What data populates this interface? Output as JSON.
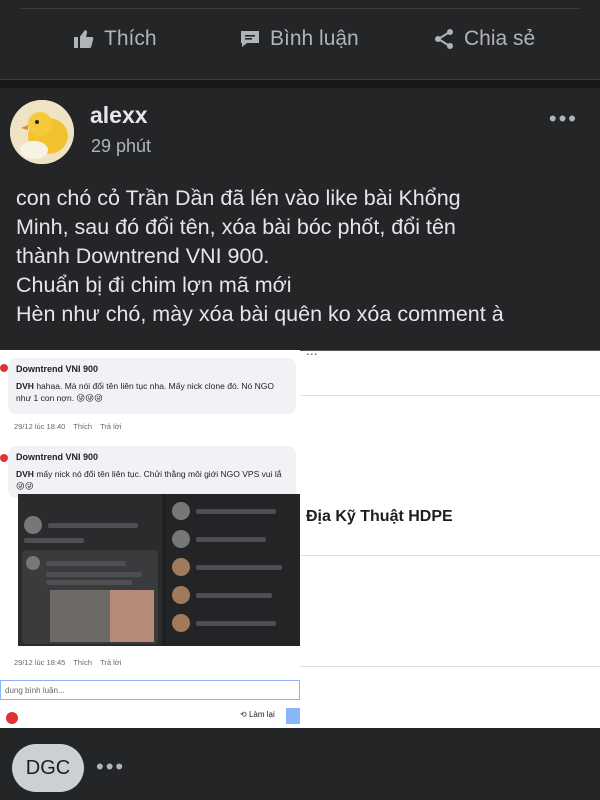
{
  "actions": {
    "like_label": "Thích",
    "comment_label": "Bình luận",
    "share_label": "Chia sẻ"
  },
  "post": {
    "author": "alexx",
    "time": "29 phút",
    "lines": [
      "con chó cỏ Trần Dần đã lén vào like bài Khổng",
      "Minh, sau đó đổi tên, xóa bài bóc phốt, đổi tên",
      "thành Downtrend VNI 900.",
      "Chuẩn bị đi chim lợn mã mới",
      "Hèn như chó, mày xóa bài quên ko xóa comment à"
    ]
  },
  "embedded_left": {
    "comment1": {
      "name": "Downtrend VNI 900",
      "prefix": "DVH",
      "text": "hahaa. Mà nói đổi tên liên tục nha. Mấy nick clone đó. Nó NGO như 1 con nợn. 😜😜😜",
      "time": "29/12 lúc 18:40",
      "like": "Thích",
      "reply": "Trả lời"
    },
    "comment2": {
      "name": "Downtrend VNI 900",
      "prefix": "DVH",
      "text": "mấy nick nó đổi tên liên tục. Chửi thằng môi giới NGO VPS vui lắ",
      "emoji": "😜😜",
      "time": "29/12 lúc 18:45",
      "like": "Thích",
      "reply": "Trả lời"
    },
    "reply_placeholder": "dung bình luận...",
    "refresh_label": "Làm lại"
  },
  "embedded_right": {
    "cut_top_text": "...",
    "title": "Địa Kỹ Thuật HDPE"
  },
  "footer": {
    "initials": "DGC"
  }
}
